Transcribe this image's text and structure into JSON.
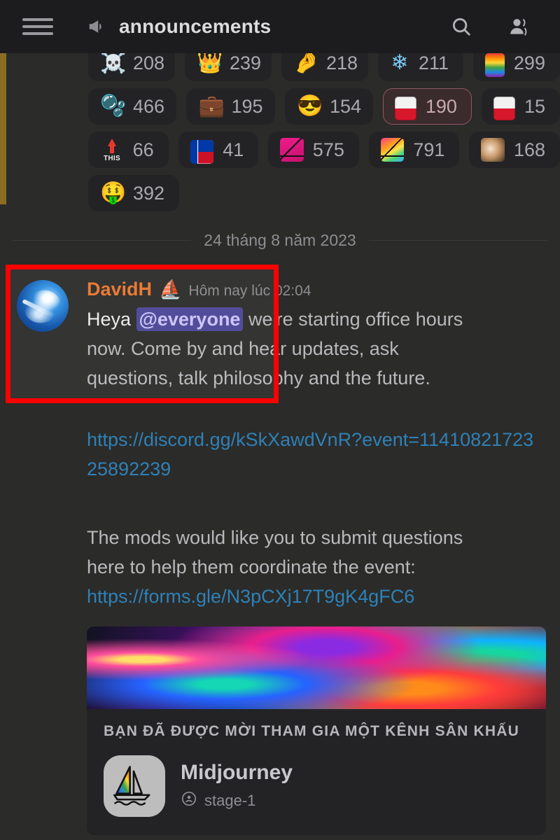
{
  "header": {
    "menu_icon": "hamburger-menu-icon",
    "channel_icon": "megaphone-icon",
    "channel_name": "announcements",
    "search_icon": "search-icon",
    "members_icon": "members-icon"
  },
  "reactions": {
    "rows": [
      [
        {
          "emoji": "skull-crossbones",
          "glyph": "☠",
          "count": "208",
          "me": false
        },
        {
          "emoji": "crown-skull",
          "glyph": "👑",
          "count": "239",
          "me": false
        },
        {
          "emoji": "scroll-hand",
          "glyph": "🤌",
          "count": "218",
          "me": false
        },
        {
          "emoji": "snowflake",
          "glyph": "❄",
          "count": "211",
          "me": false
        },
        {
          "emoji": "rainbow-flag",
          "glyph": "",
          "count": "299",
          "me": false
        }
      ],
      [
        {
          "emoji": "teal-blob",
          "glyph": "🫧",
          "count": "466",
          "me": false
        },
        {
          "emoji": "briefcase",
          "glyph": "💼",
          "count": "195",
          "me": false
        },
        {
          "emoji": "sunglasses-face",
          "glyph": "😎",
          "count": "154",
          "me": false
        },
        {
          "emoji": "poland-flag",
          "glyph": "",
          "count": "190",
          "me": true
        },
        {
          "emoji": "poland-flag",
          "glyph": "",
          "count": "15",
          "me": false
        }
      ],
      [
        {
          "emoji": "this-arrow",
          "glyph": "",
          "count": "66",
          "me": false
        },
        {
          "emoji": "philippines-flag",
          "glyph": "",
          "count": "41",
          "me": false
        },
        {
          "emoji": "pink-sailboat",
          "glyph": "",
          "count": "575",
          "me": false
        },
        {
          "emoji": "rainbow-sailboat",
          "glyph": "",
          "count": "791",
          "me": false
        },
        {
          "emoji": "dog-face",
          "glyph": "",
          "count": "168",
          "me": false
        }
      ],
      [
        {
          "emoji": "money-mouth-face",
          "glyph": "🤑",
          "count": "392",
          "me": false
        }
      ]
    ]
  },
  "date_divider": {
    "label": "24 tháng 8 năm 2023"
  },
  "message": {
    "avatar": "user-avatar",
    "username": "DavidH",
    "username_badge_emoji": "⛵",
    "timestamp": "Hôm nay lúc 02:04",
    "line1_pre": "Heya ",
    "mention": "@everyone",
    "line1_post": " we're starting office hours",
    "line2": "now. Come by and hear updates, ask",
    "line3": "questions, talk philosophy and the future.",
    "invite_link": "https://discord.gg/kSkXawdVnR?event=1141082172325892239",
    "para2_line1": "The mods would like you to submit questions",
    "para2_line2": "here to help them coordinate the event:",
    "forms_link": "https://forms.gle/N3pCXj17T9gK4gFC6"
  },
  "embed": {
    "banner": "iridescent-banner-image",
    "title": "BẠN ĐÃ ĐƯỢC MỜI THAM GIA MỘT KÊNH SÂN KHẤU",
    "server_icon": "midjourney-sailboat-icon",
    "server_name": "Midjourney",
    "channel_icon": "stage-channel-icon",
    "channel_name": "stage-1"
  },
  "annotation": {
    "highlight_box": "red-annotation-box"
  },
  "colors": {
    "accent_username": "#e8762d",
    "mention_bg": "#4b4697",
    "link": "#2f81b7",
    "pinned_bar": "#8a6d21",
    "annotation": "#ff0000",
    "background": "#2b2b29",
    "header_bg": "#1c1c1e"
  }
}
